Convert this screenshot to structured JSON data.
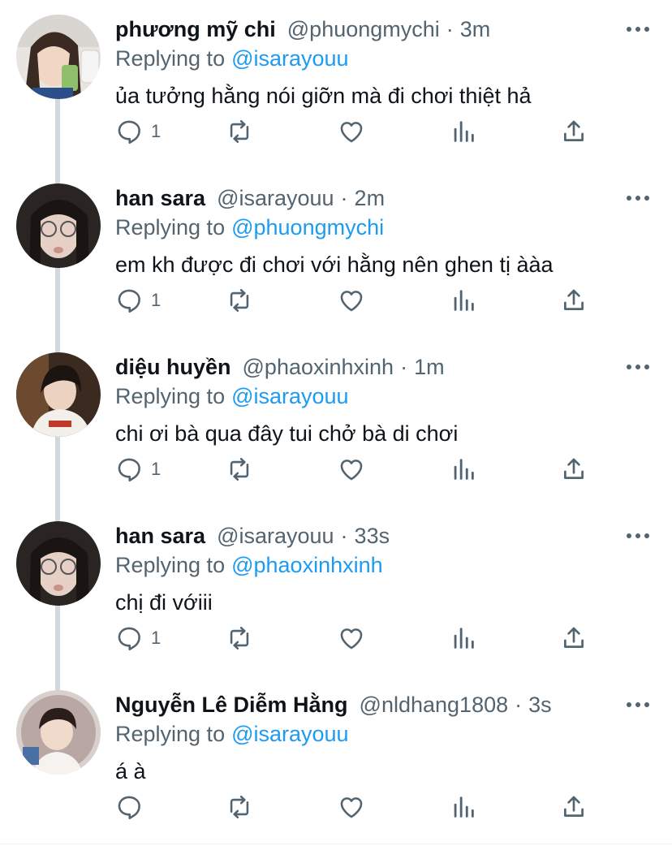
{
  "colors": {
    "accent": "#1d9bf0",
    "secondary_text": "#536471",
    "thread_line": "#cfd9de"
  },
  "reply_prefix": "Replying to",
  "tweets": [
    {
      "name": "phương mỹ chi",
      "handle": "@phuongmychi",
      "time": "3m",
      "replying_to": "@isarayouu",
      "text": "ủa tưởng hằng nói giỡn mà đi chơi thiệt hả",
      "reply_count": "1",
      "retweet_count": "",
      "like_count": ""
    },
    {
      "name": "han sara",
      "handle": "@isarayouu",
      "time": "2m",
      "replying_to": "@phuongmychi",
      "text": "em kh được đi chơi với hằng nên ghen tị ààa",
      "reply_count": "1",
      "retweet_count": "",
      "like_count": ""
    },
    {
      "name": "diệu huyền",
      "handle": "@phaoxinhxinh",
      "time": "1m",
      "replying_to": "@isarayouu",
      "text": "chi ơi bà qua đây tui chở bà di chơi",
      "reply_count": "1",
      "retweet_count": "",
      "like_count": ""
    },
    {
      "name": "han sara",
      "handle": "@isarayouu",
      "time": "33s",
      "replying_to": "@phaoxinhxinh",
      "text": "chị đi vớiii",
      "reply_count": "1",
      "retweet_count": "",
      "like_count": ""
    },
    {
      "name": "Nguyễn Lê Diễm Hằng",
      "handle": "@nldhang1808",
      "time": "3s",
      "replying_to": "@isarayouu",
      "text": "á à",
      "reply_count": "",
      "retweet_count": "",
      "like_count": ""
    }
  ]
}
